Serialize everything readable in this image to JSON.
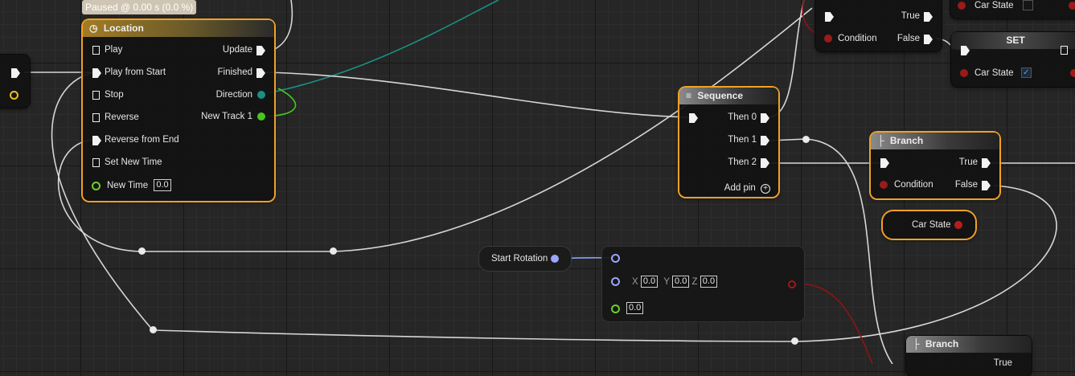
{
  "timeline_status": "Paused @ 0.00 s (0.0 %)",
  "location_node": {
    "title": "Location",
    "inputs": [
      "Play",
      "Play from Start",
      "Stop",
      "Reverse",
      "Reverse from End",
      "Set New Time"
    ],
    "new_time_label": "New Time",
    "new_time_value": "0.0",
    "outputs": [
      "Update",
      "Finished",
      "Direction",
      "New Track 1"
    ]
  },
  "sequence_node": {
    "title": "Sequence",
    "outputs": [
      "Then 0",
      "Then 1",
      "Then 2"
    ],
    "add_pin_label": "Add pin"
  },
  "branch_top": {
    "true_label": "True",
    "condition_label": "Condition",
    "false_label": "False"
  },
  "car_state_top": {
    "label": "Car State"
  },
  "set_node": {
    "title": "SET",
    "car_state_label": "Car State"
  },
  "branch_mid": {
    "title": "Branch",
    "true_label": "True",
    "condition_label": "Condition",
    "false_label": "False"
  },
  "car_state_getter": {
    "label": "Car State"
  },
  "start_rotation_getter": {
    "label": "Start Rotation"
  },
  "make_rotator": {
    "x_label": "X",
    "x_value": "0.0",
    "y_label": "Y",
    "y_value": "0.0",
    "z_label": "Z",
    "z_value": "0.0",
    "alpha_value": "0.0"
  },
  "branch_bottom": {
    "title": "Branch",
    "true_label": "True"
  },
  "colors": {
    "selection": "#f1a128",
    "bool_pin": "#9b1a1a",
    "float_pin": "#6ccf2c",
    "vector_pin": "#2aa9a0",
    "rotator_pin": "#9aa6ff"
  }
}
